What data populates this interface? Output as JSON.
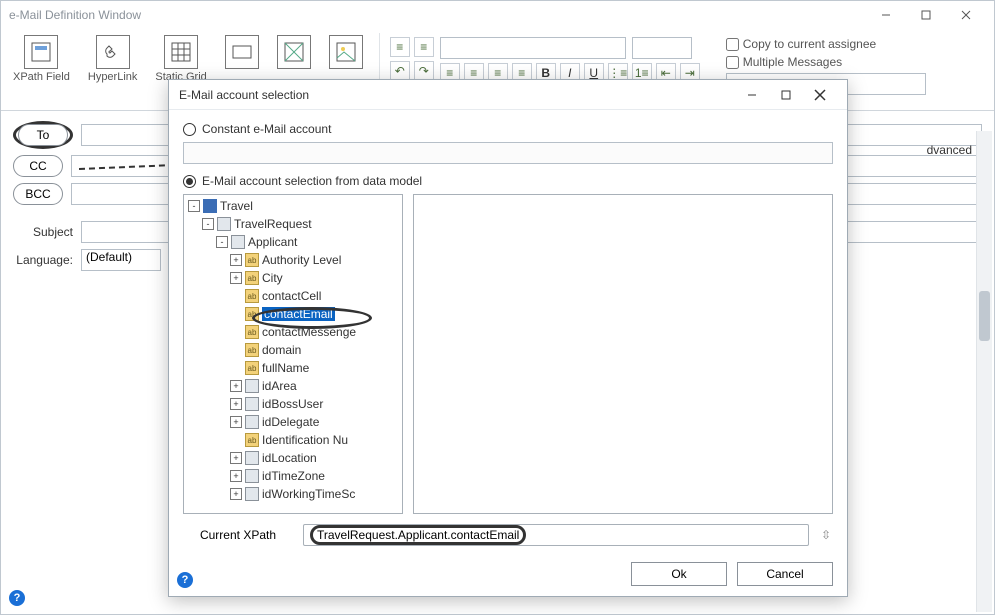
{
  "window": {
    "title": "e-Mail Definition Window"
  },
  "ribbon": {
    "xpath_field": "XPath\nField",
    "hyperlink": "HyperLink",
    "static_grid": "Static\nGrid"
  },
  "options": {
    "copy_to_assignee": "Copy to current assignee",
    "multiple_messages": "Multiple Messages"
  },
  "form": {
    "to": "To",
    "cc": "CC",
    "bcc": "BCC",
    "subject": "Subject",
    "language": "Language:",
    "language_value": "(Default)",
    "advanced_label": "dvanced"
  },
  "modal": {
    "title": "E-Mail account selection",
    "constant_label": "Constant e-Mail account",
    "datamodel_label": "E-Mail account selection from data model",
    "current_xpath_label": "Current XPath",
    "current_xpath_value": "TravelRequest.Applicant.contactEmail",
    "ok": "Ok",
    "cancel": "Cancel"
  },
  "tree": {
    "root": "Travel",
    "request": "TravelRequest",
    "applicant": "Applicant",
    "items": [
      "Authority Level",
      "City",
      "contactCell",
      "contactEmail",
      "contactMessenge",
      "domain",
      "fullName",
      "idArea",
      "idBossUser",
      "idDelegate",
      "Identification Nu",
      "idLocation",
      "idTimeZone",
      "idWorkingTimeSc"
    ],
    "selected_index": 3
  }
}
